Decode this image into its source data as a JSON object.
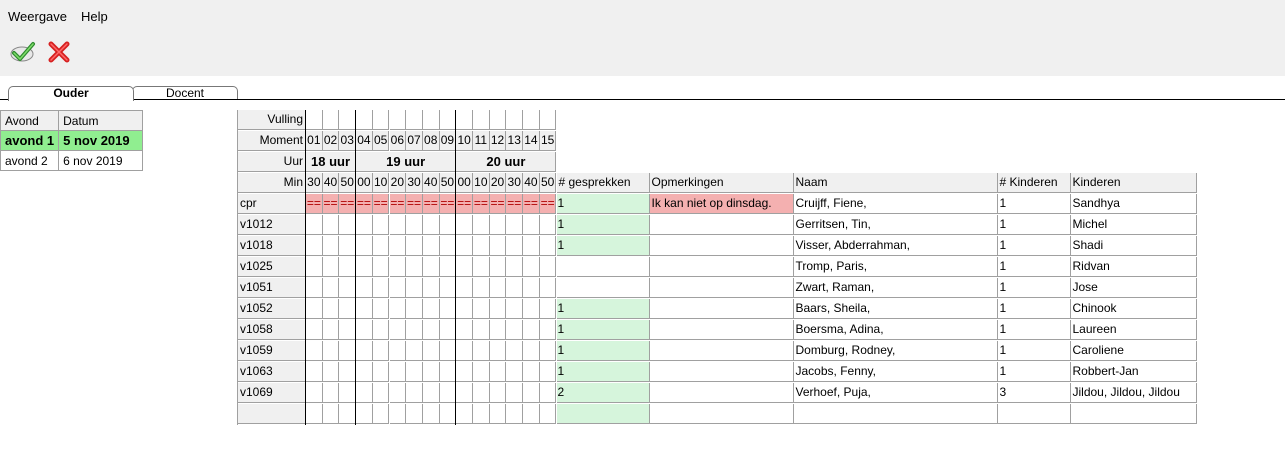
{
  "menu": [
    {
      "label": "Weergave"
    },
    {
      "label": "Help"
    }
  ],
  "toolbar": {
    "accept_icon": "check-icon",
    "cancel_icon": "close-icon"
  },
  "tabs": [
    {
      "label": "Ouder",
      "active": true
    },
    {
      "label": "Docent",
      "active": false
    }
  ],
  "avonden": {
    "headers": [
      "Avond",
      "Datum"
    ],
    "rows": [
      {
        "avond": "avond 1",
        "datum": "5 nov 2019",
        "selected": true
      },
      {
        "avond": "avond 2",
        "datum": "6 nov 2019",
        "selected": false
      }
    ]
  },
  "schedule": {
    "labels": {
      "vulling": "Vulling",
      "moment": "Moment",
      "uur": "Uur",
      "min": "Min"
    },
    "moments": [
      "01",
      "02",
      "03",
      "04",
      "05",
      "06",
      "07",
      "08",
      "09",
      "10",
      "11",
      "12",
      "13",
      "14",
      "15"
    ],
    "hours": [
      "18 uur",
      "19 uur",
      "20 uur"
    ],
    "minutes": [
      "30",
      "40",
      "50",
      "00",
      "10",
      "20",
      "30",
      "40",
      "50",
      "00",
      "10",
      "20",
      "30",
      "40",
      "50"
    ],
    "columns": [
      "# gesprekken",
      "Opmerkingen",
      "Naam",
      "# Kinderen",
      "Kinderen"
    ],
    "blocked_marker": "==",
    "rows": [
      {
        "code": "cpr",
        "gesprekken": "1",
        "opmerkingen": "Ik kan niet op dinsdag.",
        "naam": "Cruijff, Fiene,",
        "kinderen_count": "1",
        "kinderen": "Sandhya"
      },
      {
        "code": "v1012",
        "gesprekken": "1",
        "opmerkingen": "",
        "naam": "Gerritsen, Tin,",
        "kinderen_count": "1",
        "kinderen": "Michel"
      },
      {
        "code": "v1018",
        "gesprekken": "1",
        "opmerkingen": "",
        "naam": "Visser, Abderrahman,",
        "kinderen_count": "1",
        "kinderen": "Shadi"
      },
      {
        "code": "v1025",
        "gesprekken": "",
        "opmerkingen": "",
        "naam": "Tromp, Paris,",
        "kinderen_count": "1",
        "kinderen": "Ridvan"
      },
      {
        "code": "v1051",
        "gesprekken": "",
        "opmerkingen": "",
        "naam": "Zwart, Raman,",
        "kinderen_count": "1",
        "kinderen": "Jose"
      },
      {
        "code": "v1052",
        "gesprekken": "1",
        "opmerkingen": "",
        "naam": "Baars, Sheila,",
        "kinderen_count": "1",
        "kinderen": "Chinook"
      },
      {
        "code": "v1058",
        "gesprekken": "1",
        "opmerkingen": "",
        "naam": "Boersma, Adina,",
        "kinderen_count": "1",
        "kinderen": "Laureen"
      },
      {
        "code": "v1059",
        "gesprekken": "1",
        "opmerkingen": "",
        "naam": "Domburg, Rodney,",
        "kinderen_count": "1",
        "kinderen": "Caroliene"
      },
      {
        "code": "v1063",
        "gesprekken": "1",
        "opmerkingen": "",
        "naam": "Jacobs, Fenny,",
        "kinderen_count": "1",
        "kinderen": "Robbert-Jan"
      },
      {
        "code": "v1069",
        "gesprekken": "2",
        "opmerkingen": "",
        "naam": "Verhoef, Puja,",
        "kinderen_count": "3",
        "kinderen": "Jildou, Jildou, Jildou"
      }
    ]
  }
}
